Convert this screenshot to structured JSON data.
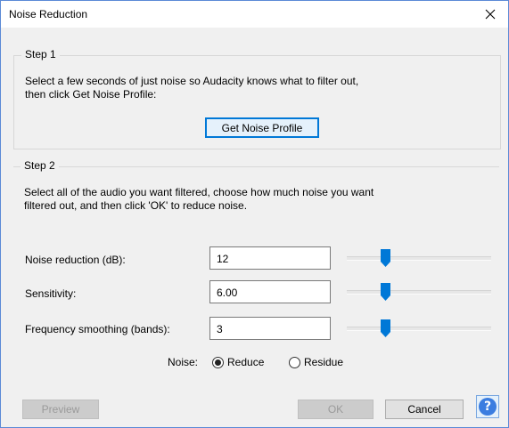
{
  "window": {
    "title": "Noise Reduction",
    "close_glyph": "close-icon"
  },
  "step1": {
    "label": "Step 1",
    "description_line1": "Select a few seconds of just noise so Audacity knows what to filter out,",
    "description_line2": "then click Get Noise Profile:",
    "button_label": "Get Noise Profile"
  },
  "step2": {
    "label": "Step 2",
    "description_line1": "Select all of the audio you want filtered, choose how much noise you want",
    "description_line2": "filtered out, and then click 'OK' to reduce noise.",
    "rows": [
      {
        "label": "Noise reduction (dB):",
        "value": "12"
      },
      {
        "label": "Sensitivity:",
        "value": "6.00"
      },
      {
        "label": "Frequency smoothing (bands):",
        "value": "3"
      }
    ],
    "noise_label": "Noise:",
    "noise_options": [
      {
        "label": "Reduce",
        "checked": true
      },
      {
        "label": "Residue",
        "checked": false
      }
    ]
  },
  "footer": {
    "preview_label": "Preview",
    "ok_label": "OK",
    "cancel_label": "Cancel",
    "help_glyph": "?"
  },
  "colors": {
    "accent": "#0078d7",
    "slider_thumb": "#0078d7",
    "help": "#3b7de0"
  }
}
